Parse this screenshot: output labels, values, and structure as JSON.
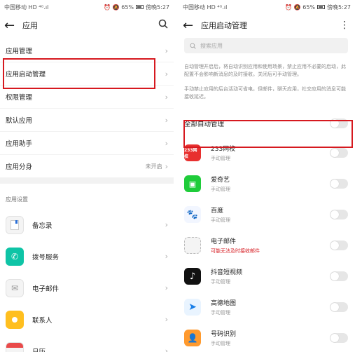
{
  "left": {
    "status": {
      "carrier": "中国移动",
      "signal": "HD ⁴ᴳ.ıl",
      "icons": "⏰ 🔕 65%",
      "time": "傍晚5:27"
    },
    "appbar": {
      "title": "应用"
    },
    "menu": [
      {
        "label": "应用管理",
        "value": ""
      },
      {
        "label": "应用启动管理",
        "value": ""
      },
      {
        "label": "权限管理",
        "value": ""
      },
      {
        "label": "默认应用",
        "value": ""
      },
      {
        "label": "应用助手",
        "value": ""
      },
      {
        "label": "应用分身",
        "value": "未开启"
      }
    ],
    "section_title": "应用设置",
    "apps": [
      {
        "label": "备忘录",
        "icon": "notes-icon",
        "color": "#f4f4f4"
      },
      {
        "label": "拨号服务",
        "icon": "phone-icon",
        "color": "#0ec4a6"
      },
      {
        "label": "电子邮件",
        "icon": "mail-icon",
        "color": "#f4f4f4"
      },
      {
        "label": "联系人",
        "icon": "contacts-icon",
        "color": "#ffbf1f"
      },
      {
        "label": "日历",
        "icon": "calendar-icon",
        "color": "#f4f4f4"
      }
    ]
  },
  "right": {
    "status": {
      "carrier": "中国移动",
      "signal": "HD ⁴ᴳ.ıl",
      "icons": "⏰ 🔕 65%",
      "time": "傍晚5:27"
    },
    "appbar": {
      "title": "应用启动管理"
    },
    "search_placeholder": "搜索应用",
    "desc1": "自动管理开启后，将自动识别应用和使用场景，禁止应用不必要的启动，此配置不会影响新消息的及时接收。关闭后可手动管理。",
    "desc2": "手动禁止应用的后台活动可省电，但邮件，聊天应用，社交应用的消息可能接收延迟。",
    "all_label": "全部自动管理",
    "apps": [
      {
        "name": "233网校",
        "sub": "手动管理",
        "icon_text": "233网校",
        "color": "#e8302f",
        "warn": false
      },
      {
        "name": "爱奇艺",
        "sub": "手动管理",
        "icon_text": "▣",
        "color": "#1fcc3a",
        "warn": false
      },
      {
        "name": "百度",
        "sub": "手动管理",
        "icon_text": "🐾",
        "color": "#f2f6ff",
        "warn": false
      },
      {
        "name": "电子邮件",
        "sub": "可能无法及时接收邮件",
        "icon_text": "",
        "color": "#f4f4f4",
        "warn": true
      },
      {
        "name": "抖音短视频",
        "sub": "手动管理",
        "icon_text": "♪",
        "color": "#111111",
        "warn": false
      },
      {
        "name": "高德地图",
        "sub": "手动管理",
        "icon_text": "➤",
        "color": "#e9f4ff",
        "warn": false
      },
      {
        "name": "号码识别",
        "sub": "手动管理",
        "icon_text": "👤",
        "color": "#ff9a2e",
        "warn": false
      }
    ]
  }
}
